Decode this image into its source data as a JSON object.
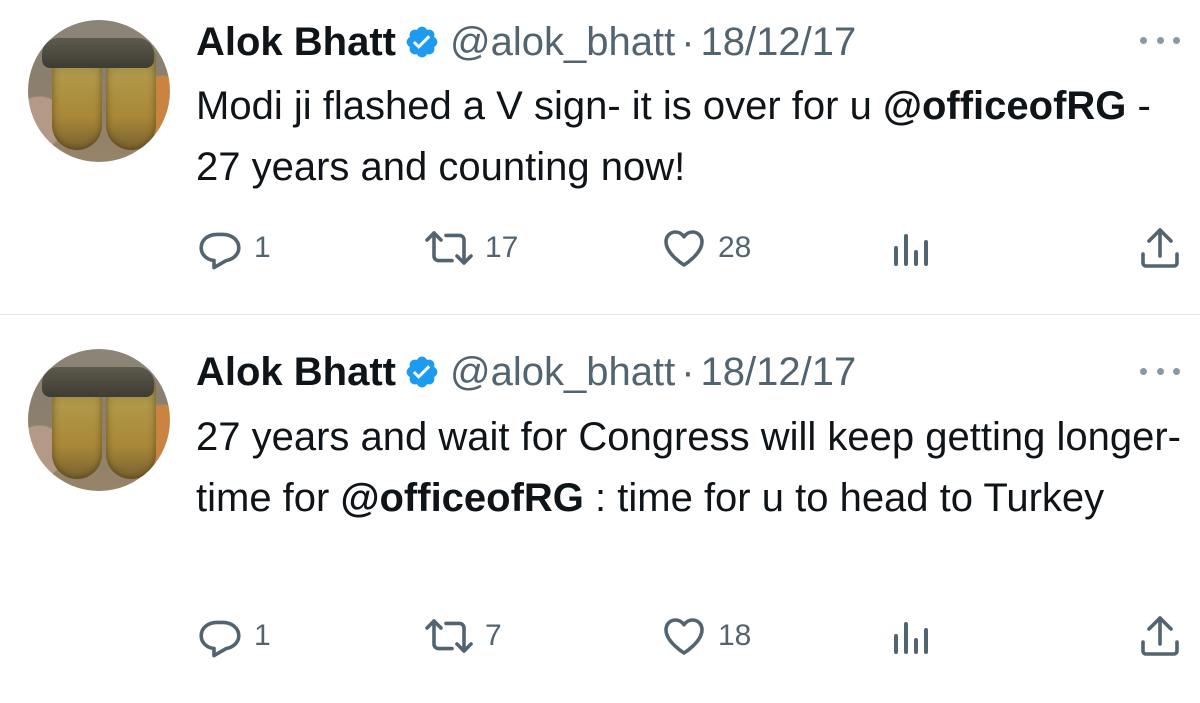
{
  "tweets": [
    {
      "author": "Alok Bhatt",
      "handle": "@alok_bhatt",
      "separator": "·",
      "date": "18/12/17",
      "text_parts": [
        {
          "text": "Modi ji flashed a V sign- it is over for u "
        },
        {
          "text": "@officeofRG",
          "mention": true
        },
        {
          "text": " - 27 years and counting now!"
        }
      ],
      "replies": "1",
      "retweets": "17",
      "likes": "28"
    },
    {
      "author": "Alok Bhatt",
      "handle": "@alok_bhatt",
      "separator": "·",
      "date": "18/12/17",
      "text_parts": [
        {
          "text": "27 years and wait for Congress will keep getting longer- time for "
        },
        {
          "text": "@officeofRG",
          "mention": true
        },
        {
          "text": " : time for u to head to Turkey"
        }
      ],
      "replies": "1",
      "retweets": "7",
      "likes": "18"
    }
  ],
  "icons": {
    "verified": "verified-badge-icon",
    "more": "more-options-icon",
    "reply": "reply-icon",
    "retweet": "retweet-icon",
    "like": "heart-icon",
    "views": "views-icon",
    "share": "share-icon"
  },
  "colors": {
    "verified": "#1d9bf0",
    "secondary_text": "#536471",
    "primary_text": "#0f1419",
    "divider": "#e6e6e6"
  }
}
